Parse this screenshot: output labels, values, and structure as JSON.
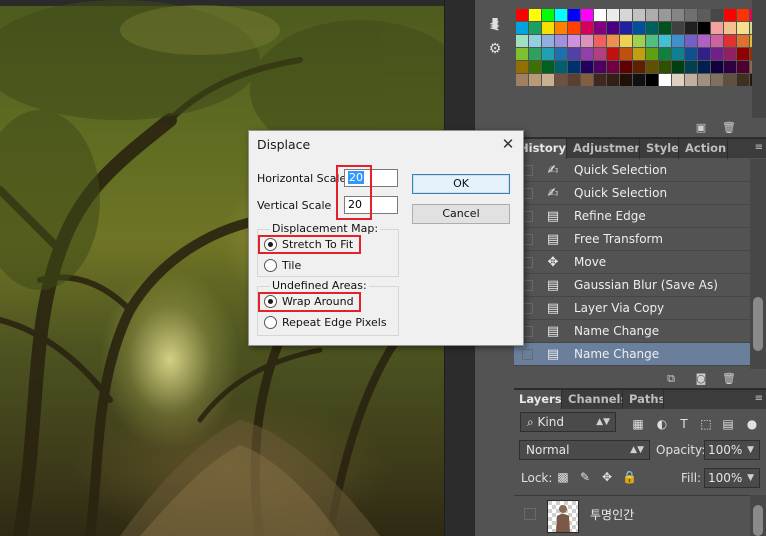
{
  "swatches": {
    "colors": [
      "#ff0000",
      "#ffff00",
      "#00ff00",
      "#00ffff",
      "#0000ff",
      "#ff00ff",
      "#ffffff",
      "#ebebeb",
      "#d6d6d6",
      "#c2c2c2",
      "#adadad",
      "#999999",
      "#858585",
      "#707070",
      "#5c5c5c",
      "#474747",
      "#ff0000",
      "#ff3300",
      "#e6005c",
      "#00a3e0",
      "#1aa060",
      "#f5e000",
      "#ff8000",
      "#ff4000",
      "#d6005a",
      "#800080",
      "#4b0082",
      "#2020a0",
      "#0050a0",
      "#006060",
      "#005020",
      "#404040",
      "#202020",
      "#000000",
      "#f2a0a0",
      "#f5c090",
      "#f5e090",
      "#c8e090",
      "#a0e0c0",
      "#90d0e0",
      "#90b0e0",
      "#a090e0",
      "#d090e0",
      "#e090c0",
      "#f06060",
      "#f09050",
      "#f0d050",
      "#a0d050",
      "#50c080",
      "#40c0d0",
      "#4090d0",
      "#7060c8",
      "#b060c8",
      "#d060a0",
      "#e03030",
      "#e07030",
      "#e0c030",
      "#80c030",
      "#30a060",
      "#20a0b0",
      "#2070b0",
      "#5040a8",
      "#9040a8",
      "#b04080",
      "#c01010",
      "#c05010",
      "#c0a010",
      "#60a010",
      "#108040",
      "#108090",
      "#105090",
      "#302088",
      "#702088",
      "#902060",
      "#900000",
      "#903000",
      "#907000",
      "#407000",
      "#006020",
      "#006070",
      "#003070",
      "#200060",
      "#500060",
      "#700040",
      "#600000",
      "#602000",
      "#605000",
      "#305000",
      "#004010",
      "#004050",
      "#002050",
      "#100040",
      "#300040",
      "#500030",
      "#8a6a50",
      "#a08060",
      "#b89a78",
      "#c8b090",
      "#705040",
      "#5a4030",
      "#806040",
      "#402820",
      "#302018",
      "#201008",
      "#101010",
      "#000000",
      "#ffffff",
      "#e0d0c0",
      "#c0b0a0",
      "#a09080",
      "#807060",
      "#605040",
      "#403020",
      "#201810"
    ]
  },
  "history_tabs": [
    "History",
    "Adjustments",
    "Styles",
    "Actions"
  ],
  "history": {
    "items": [
      {
        "label": "Quick Selection",
        "icon": "brush-icon",
        "selected": false
      },
      {
        "label": "Quick Selection",
        "icon": "brush-icon",
        "selected": false
      },
      {
        "label": "Refine Edge",
        "icon": "document-icon",
        "selected": false
      },
      {
        "label": "Free Transform",
        "icon": "document-icon",
        "selected": false
      },
      {
        "label": "Move",
        "icon": "move-icon",
        "selected": false
      },
      {
        "label": "Gaussian Blur (Save As)",
        "icon": "document-icon",
        "selected": false
      },
      {
        "label": "Layer Via Copy",
        "icon": "document-icon",
        "selected": false
      },
      {
        "label": "Name Change",
        "icon": "document-icon",
        "selected": false
      },
      {
        "label": "Name Change",
        "icon": "document-icon",
        "selected": true
      }
    ]
  },
  "layers_tabs": [
    "Layers",
    "Channels",
    "Paths"
  ],
  "layers": {
    "filter_kind": "Kind",
    "blend_mode": "Normal",
    "opacity_label": "Opacity:",
    "opacity_value": "100%",
    "lock_label": "Lock:",
    "fill_label": "Fill:",
    "fill_value": "100%",
    "layer_name": "투명인간"
  },
  "dialog": {
    "title": "Displace",
    "horizontal_scale_label": "Horizontal Scale",
    "horizontal_scale_value": "20",
    "vertical_scale_label": "Vertical Scale",
    "vertical_scale_value": "20",
    "ok_label": "OK",
    "cancel_label": "Cancel",
    "displacement_map_title": "Displacement Map:",
    "displacement_options": [
      "Stretch To Fit",
      "Tile"
    ],
    "displacement_selected": "Stretch To Fit",
    "undefined_areas_title": "Undefined Areas:",
    "undefined_options": [
      "Wrap Around",
      "Repeat Edge Pixels"
    ],
    "undefined_selected": "Wrap Around"
  },
  "colors": {
    "highlight_box": "#e2212b",
    "selected_row": "#6a7f9c",
    "panel_bg": "#535353"
  }
}
